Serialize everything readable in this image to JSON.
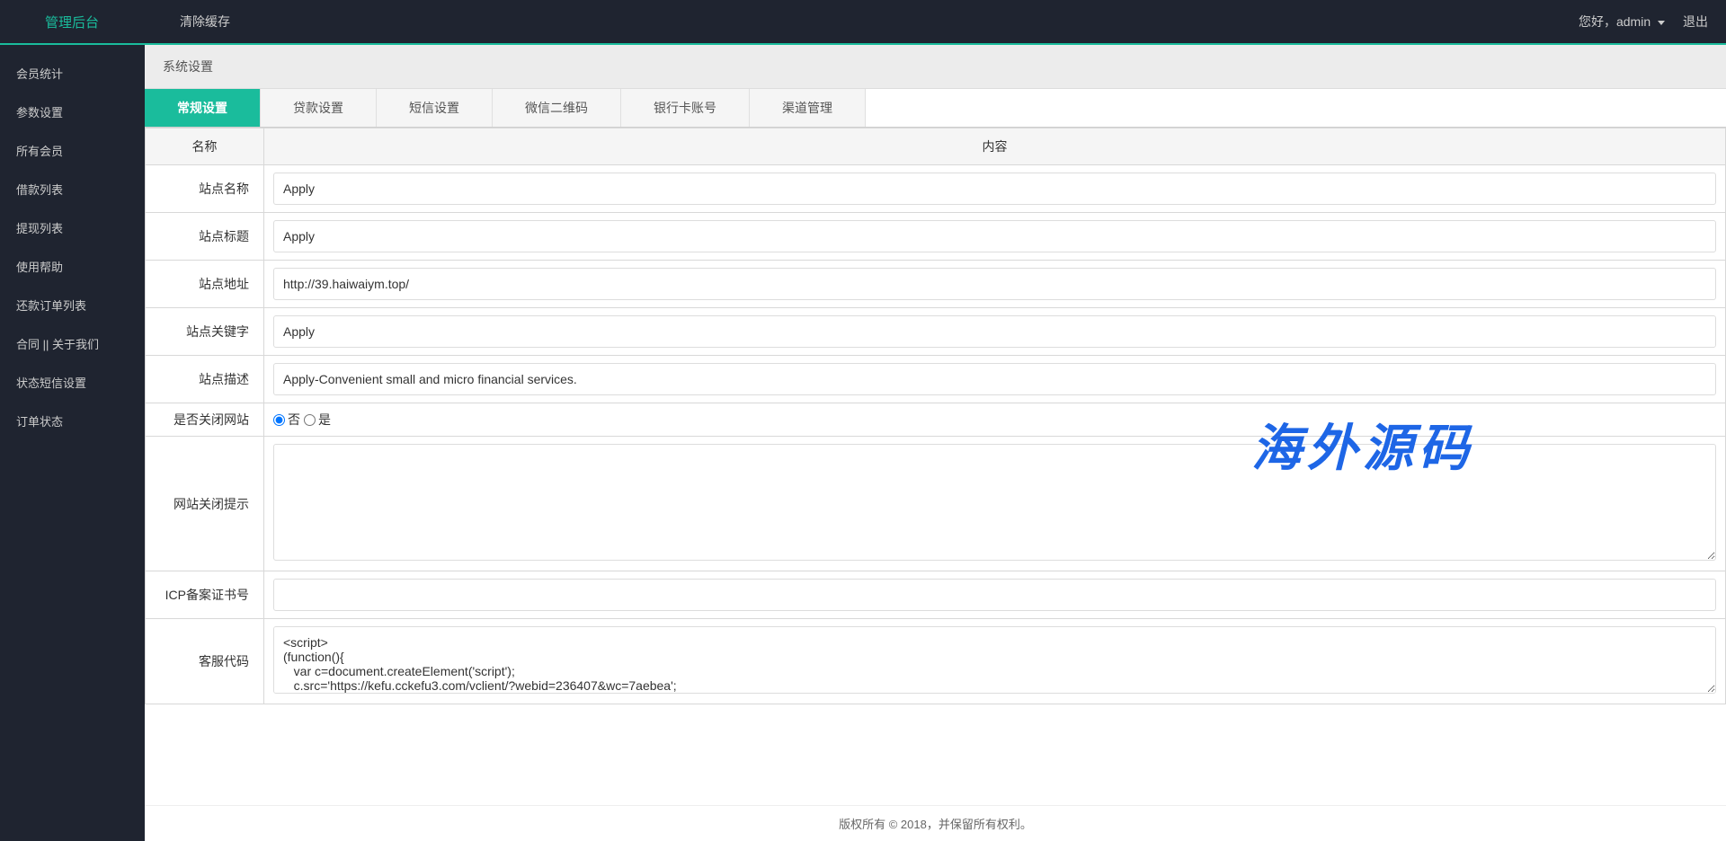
{
  "topbar": {
    "brand": "管理后台",
    "clear_cache": "清除缓存",
    "greeting": "您好，admin",
    "logout": "退出"
  },
  "sidebar": {
    "items": [
      "会员统计",
      "参数设置",
      "所有会员",
      "借款列表",
      "提现列表",
      "使用帮助",
      "还款订单列表",
      "合同 || 关于我们",
      "状态短信设置",
      "订单状态"
    ]
  },
  "breadcrumb": "系统设置",
  "tabs": [
    {
      "label": "常规设置",
      "active": true
    },
    {
      "label": "贷款设置",
      "active": false
    },
    {
      "label": "短信设置",
      "active": false
    },
    {
      "label": "微信二维码",
      "active": false
    },
    {
      "label": "银行卡账号",
      "active": false
    },
    {
      "label": "渠道管理",
      "active": false
    }
  ],
  "table": {
    "header_name": "名称",
    "header_content": "内容",
    "rows": {
      "site_name": {
        "label": "站点名称",
        "value": "Apply"
      },
      "site_title": {
        "label": "站点标题",
        "value": "Apply"
      },
      "site_url": {
        "label": "站点地址",
        "value": "http://39.haiwaiym.top/"
      },
      "site_keywords": {
        "label": "站点关键字",
        "value": "Apply"
      },
      "site_desc": {
        "label": "站点描述",
        "value": "Apply-Convenient small and micro financial services."
      },
      "close_site": {
        "label": "是否关闭网站",
        "option_no": "否",
        "option_yes": "是",
        "value": "no"
      },
      "close_tip": {
        "label": "网站关闭提示",
        "value": ""
      },
      "icp": {
        "label": "ICP备案证书号",
        "value": ""
      },
      "service_code": {
        "label": "客服代码",
        "value": "<script>\n(function(){\n   var c=document.createElement('script');\n   c.src='https://kefu.cckefu3.com/vclient/?webid=236407&wc=7aebea';"
      }
    }
  },
  "watermark": "海外源码",
  "footer": "版权所有 © 2018，并保留所有权利。"
}
